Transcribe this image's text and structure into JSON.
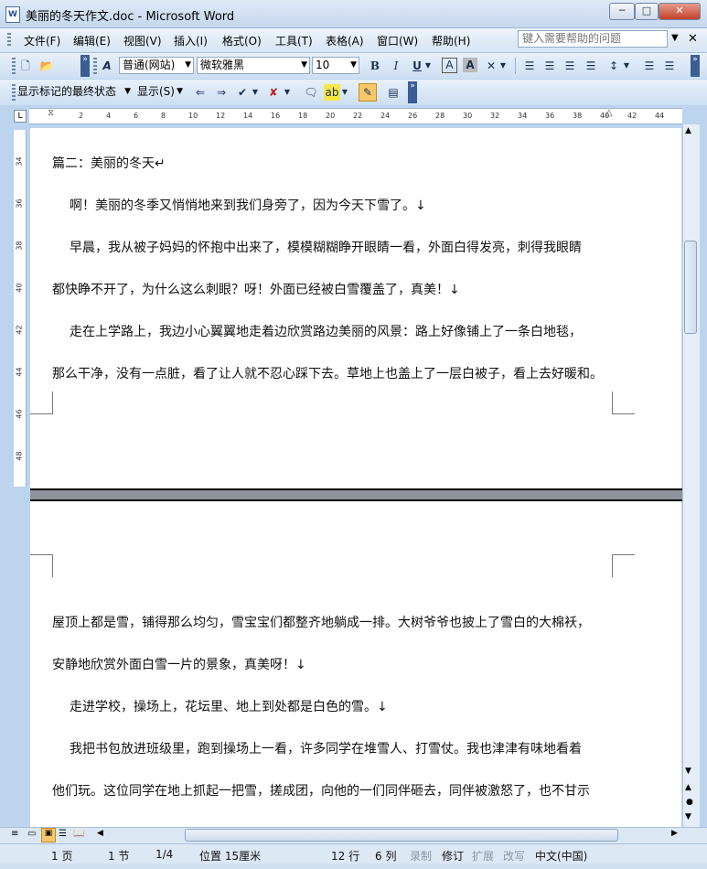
{
  "window": {
    "title": "美丽的冬天作文.doc - Microsoft Word"
  },
  "menu": [
    "文件(F)",
    "编辑(E)",
    "视图(V)",
    "插入(I)",
    "格式(O)",
    "工具(T)",
    "表格(A)",
    "窗口(W)",
    "帮助(H)"
  ],
  "help_box": {
    "placeholder": "键入需要帮助的问题"
  },
  "formatting": {
    "style": "普通(网站)",
    "font": "微软雅黑",
    "size": "10"
  },
  "reviewing": {
    "display_mode": "显示标记的最终状态",
    "show_label": "显示(S)"
  },
  "ruler": {
    "h_ticks": [
      "2",
      "4",
      "6",
      "8",
      "10",
      "12",
      "14",
      "16",
      "18",
      "20",
      "22",
      "24",
      "26",
      "28",
      "30",
      "32",
      "34",
      "36",
      "38",
      "40",
      "42",
      "44"
    ],
    "v_ticks": [
      "34",
      "36",
      "38",
      "40",
      "42",
      "44",
      "46",
      "48"
    ]
  },
  "document": {
    "page1_lines": [
      "篇二：美丽的冬天↵",
      "啊！美丽的冬季又悄悄地来到我们身旁了，因为今天下雪了。↓",
      "早晨，我从被子妈妈的怀抱中出来了，模模糊糊睁开眼睛一看，外面白得发亮，刺得我眼睛",
      "都快睁不开了，为什么这么刺眼？呀！外面已经被白雪覆盖了，真美！↓",
      "走在上学路上，我边小心翼翼地走着边欣赏路边美丽的风景：路上好像铺上了一条白地毯，",
      "那么干净，没有一点脏，看了让人就不忍心踩下去。草地上也盖上了一层白被子，看上去好暖和。"
    ],
    "page2_lines": [
      "屋顶上都是雪，铺得那么均匀，雪宝宝们都整齐地躺成一排。大树爷爷也披上了雪白的大棉袄，",
      "安静地欣赏外面白雪一片的景象，真美呀！↓",
      "走进学校，操场上，花坛里、地上到处都是白色的雪。↓",
      "我把书包放进班级里，跑到操场上一看，许多同学在堆雪人、打雪仗。我也津津有味地看着",
      "他们玩。这位同学在地上抓起一把雪，搓成团，向他的一们同伴砸去，同伴被激怒了，也不甘示"
    ]
  },
  "status": {
    "page": "1 页",
    "section": "1 节",
    "pages": "1/4",
    "position": "位置 15厘米",
    "line": "12 行",
    "col": "6 列",
    "rec": "录制",
    "trk": "修订",
    "ext": "扩展",
    "ovr": "改写",
    "lang": "中文(中国)"
  },
  "colors": {
    "chrome": "#bcd4ee",
    "page_break": "#8f939b"
  }
}
